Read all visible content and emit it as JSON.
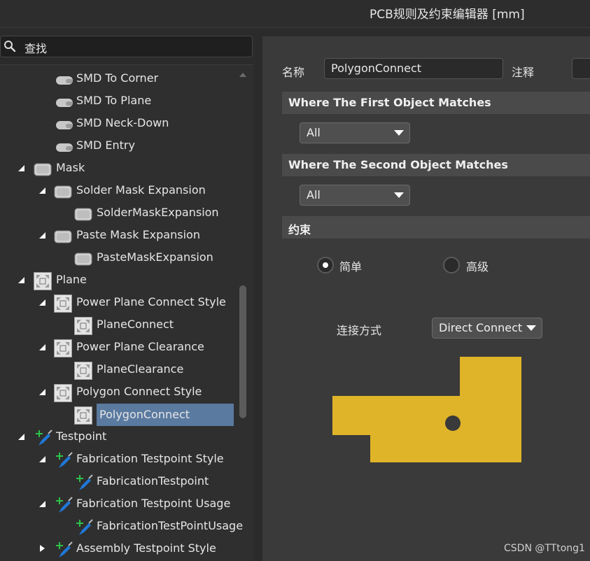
{
  "window": {
    "title": "PCB规则及约束编辑器 [mm]"
  },
  "search": {
    "label": "查找",
    "icon": "search-icon"
  },
  "tree": [
    {
      "label": "SMD To Corner",
      "indent": 2,
      "icon": "smd-rule-icon",
      "arrow": "none"
    },
    {
      "label": "SMD To Plane",
      "indent": 2,
      "icon": "smd-rule-icon",
      "arrow": "none"
    },
    {
      "label": "SMD Neck-Down",
      "indent": 2,
      "icon": "smd-rule-icon",
      "arrow": "none"
    },
    {
      "label": "SMD Entry",
      "indent": 2,
      "icon": "smd-rule-icon",
      "arrow": "none"
    },
    {
      "label": "Mask",
      "indent": 1,
      "icon": "mask-rule-icon",
      "arrow": "expanded"
    },
    {
      "label": "Solder Mask Expansion",
      "indent": 2,
      "icon": "mask-rule-icon",
      "arrow": "expanded"
    },
    {
      "label": "SolderMaskExpansion",
      "indent": 3,
      "icon": "mask-rule-icon",
      "arrow": "none"
    },
    {
      "label": "Paste Mask Expansion",
      "indent": 2,
      "icon": "mask-rule-icon",
      "arrow": "expanded"
    },
    {
      "label": "PasteMaskExpansion",
      "indent": 3,
      "icon": "mask-rule-icon",
      "arrow": "none"
    },
    {
      "label": "Plane",
      "indent": 1,
      "icon": "plane-rule-icon",
      "arrow": "expanded"
    },
    {
      "label": "Power Plane Connect Style",
      "indent": 2,
      "icon": "plane-rule-icon",
      "arrow": "expanded"
    },
    {
      "label": "PlaneConnect",
      "indent": 3,
      "icon": "plane-rule-icon",
      "arrow": "none"
    },
    {
      "label": "Power Plane Clearance",
      "indent": 2,
      "icon": "plane-rule-icon",
      "arrow": "expanded"
    },
    {
      "label": "PlaneClearance",
      "indent": 3,
      "icon": "plane-rule-icon",
      "arrow": "none"
    },
    {
      "label": "Polygon Connect Style",
      "indent": 2,
      "icon": "plane-rule-icon",
      "arrow": "expanded"
    },
    {
      "label": "PolygonConnect",
      "indent": 3,
      "icon": "plane-rule-icon",
      "arrow": "none",
      "selected": true
    },
    {
      "label": "Testpoint",
      "indent": 1,
      "icon": "testpoint-rule-icon",
      "arrow": "expanded"
    },
    {
      "label": "Fabrication Testpoint Style",
      "indent": 2,
      "icon": "testpoint-rule-icon",
      "arrow": "expanded"
    },
    {
      "label": "FabricationTestpoint",
      "indent": 3,
      "icon": "testpoint-rule-icon",
      "arrow": "none"
    },
    {
      "label": "Fabrication Testpoint Usage",
      "indent": 2,
      "icon": "testpoint-rule-icon",
      "arrow": "expanded"
    },
    {
      "label": "FabricationTestPointUsage",
      "indent": 3,
      "icon": "testpoint-rule-icon",
      "arrow": "none"
    },
    {
      "label": "Assembly Testpoint Style",
      "indent": 2,
      "icon": "testpoint-rule-icon",
      "arrow": "collapsed"
    }
  ],
  "rule": {
    "name_label": "名称",
    "name_value": "PolygonConnect",
    "comment_label": "注释",
    "comment_value": "",
    "first_match_title": "Where The First Object Matches",
    "first_match_value": "All",
    "second_match_title": "Where The Second Object Matches",
    "second_match_value": "All",
    "constraints_title": "约束",
    "mode_simple": "简单",
    "mode_advanced": "高级",
    "mode_selected": "simple",
    "connect_label": "连接方式",
    "connect_value": "Direct Connect"
  },
  "colors": {
    "selection": "#5a7aa0",
    "copper": "#e0b428",
    "via": "#3a3a3a"
  },
  "watermark": "CSDN @TTtong1"
}
